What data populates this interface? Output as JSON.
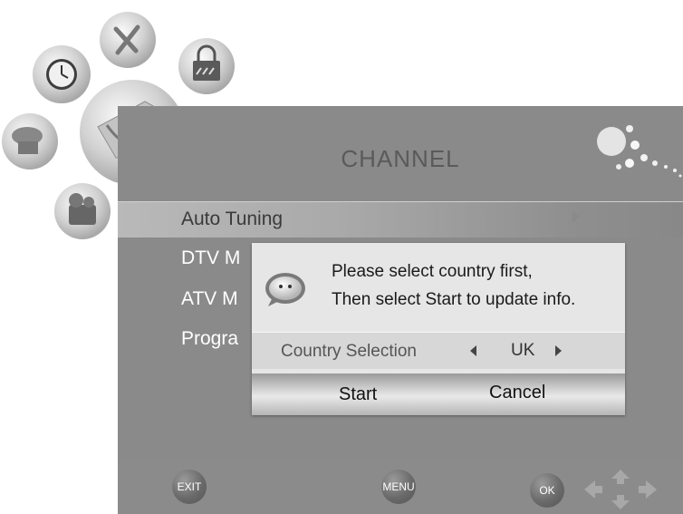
{
  "menu": {
    "title": "CHANNEL",
    "items": [
      {
        "label": "Auto Tuning"
      },
      {
        "label": "DTV M"
      },
      {
        "label": "ATV M"
      },
      {
        "label": "Progra"
      }
    ]
  },
  "dialog": {
    "message_line1": "Please select country first,",
    "message_line2": "Then select Start to update info.",
    "country_label": "Country Selection",
    "country_value": "UK",
    "start_label": "Start",
    "cancel_label": "Cancel"
  },
  "footer": {
    "exit_label": "EXIT",
    "menu_label": "MENU",
    "ok_label": "OK"
  },
  "icons": [
    "clock-icon",
    "tools-icon",
    "lock-icon",
    "channel-dish-icon",
    "sound-icon",
    "camera-icon"
  ],
  "colors": {
    "panel": "#8a8a8a",
    "highlight": "#b9b9b9",
    "dialog": "#e6e6e6",
    "text_white": "#ffffff"
  }
}
